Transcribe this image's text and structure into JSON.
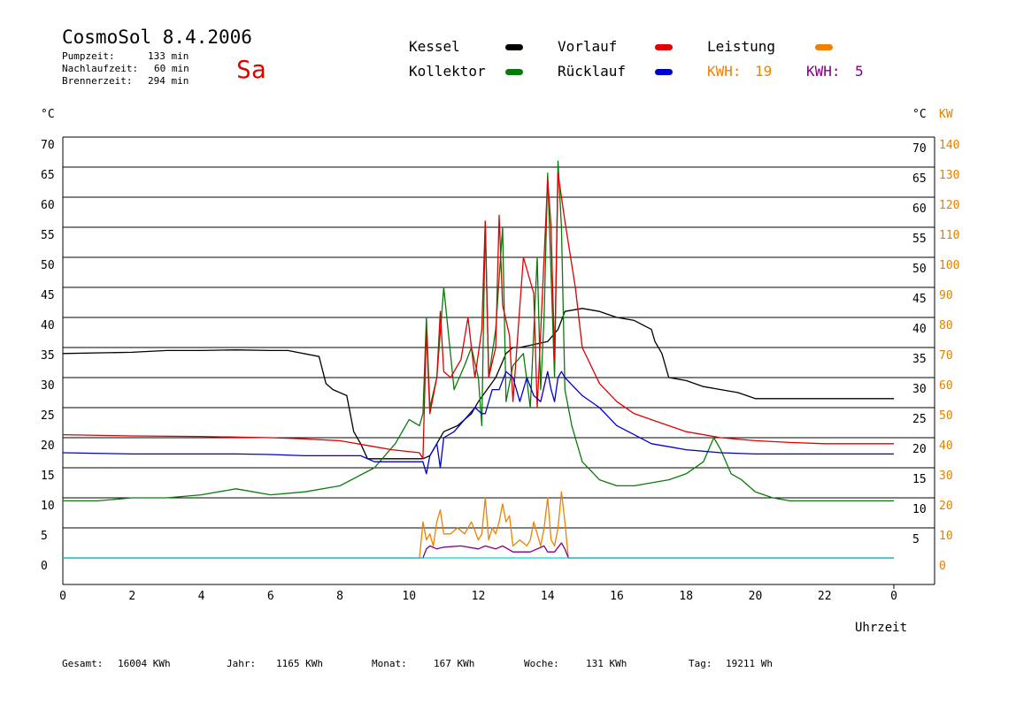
{
  "header": {
    "title": "CosmoSol 8.4.2006",
    "day": "Sa",
    "stats": [
      {
        "label": "Pumpzeit:",
        "value": "133 min"
      },
      {
        "label": "Nachlaufzeit:",
        "value": "60 min"
      },
      {
        "label": "Brennerzeit:",
        "value": "294 min"
      }
    ]
  },
  "legend": {
    "kessel": "Kessel",
    "kollektor": "Kollektor",
    "vorlauf": "Vorlauf",
    "ruecklauf": "Rücklauf",
    "leistung": "Leistung",
    "kwh1_label": "KWH:",
    "kwh1_value": "19",
    "kwh2_label": "KWH:",
    "kwh2_value": "5"
  },
  "colors": {
    "kessel": "#000000",
    "kollektor": "#0a7a0a",
    "vorlauf": "#e00000",
    "ruecklauf": "#0000cc",
    "leistung": "#f08000",
    "kwh2": "#800080",
    "pump": "#00d8d8",
    "kw_axis": "#e08000"
  },
  "footer": {
    "gesamt_label": "Gesamt:",
    "gesamt_value": "16004 KWh",
    "jahr_label": "Jahr:",
    "jahr_value": "1165 KWh",
    "monat_label": "Monat:",
    "monat_value": "167 KWh",
    "woche_label": "Woche:",
    "woche_value": "131 KWh",
    "tag_label": "Tag:",
    "tag_value": "19211 Wh"
  },
  "chart_data": {
    "type": "line",
    "xlabel": "Uhrzeit",
    "ylabel_left": "°C",
    "ylabel_right_c": "°C",
    "ylabel_right_kw": "KW",
    "xlim": [
      0,
      24
    ],
    "ylim": [
      0,
      70
    ],
    "y2lim": [
      0,
      140
    ],
    "grid": true,
    "x_ticks": [
      "0",
      "2",
      "4",
      "6",
      "8",
      "10",
      "12",
      "14",
      "16",
      "18",
      "20",
      "22",
      "0"
    ],
    "y_left_ticks": [
      "0",
      "5",
      "10",
      "15",
      "20",
      "25",
      "30",
      "35",
      "40",
      "45",
      "50",
      "55",
      "60",
      "65",
      "70"
    ],
    "y_right_c_ticks": [
      "5",
      "10",
      "15",
      "20",
      "25",
      "30",
      "35",
      "40",
      "45",
      "50",
      "55",
      "60",
      "65",
      "70"
    ],
    "y_right_kw_ticks": [
      "0",
      "10",
      "20",
      "30",
      "40",
      "50",
      "60",
      "70",
      "80",
      "90",
      "100",
      "110",
      "120",
      "130",
      "140"
    ],
    "series": [
      {
        "name": "Kessel",
        "color": "#000000",
        "x": [
          0,
          2,
          3,
          4,
          5,
          6,
          6.5,
          7.4,
          7.6,
          7.8,
          8.2,
          8.4,
          8.6,
          8.8,
          9.5,
          10.2,
          10.4,
          10.6,
          11,
          11.4,
          11.8,
          12,
          12.5,
          12.8,
          13,
          13.2,
          14,
          14.3,
          14.5,
          15,
          15.5,
          16,
          16.5,
          17,
          17.1,
          17.3,
          17.5,
          18,
          18.5,
          19,
          19.5,
          20,
          20.5,
          21,
          22,
          23,
          24
        ],
        "y": [
          34,
          34.2,
          34.5,
          34.5,
          34.6,
          34.5,
          34.5,
          33.5,
          29,
          28,
          27,
          21,
          19,
          16.5,
          16.5,
          16.5,
          16.5,
          17,
          21,
          22,
          24,
          26,
          30,
          34,
          35,
          35,
          36,
          38,
          41,
          41.5,
          41,
          40,
          39.5,
          38,
          36,
          34,
          30,
          29.5,
          28.5,
          28,
          27.5,
          26.5,
          26.5,
          26.5,
          26.5,
          26.5,
          26.5
        ]
      },
      {
        "name": "Kollektor",
        "color": "#0a7a0a",
        "x": [
          0,
          1,
          2,
          3,
          4,
          5,
          6,
          7,
          8,
          9,
          9.6,
          10,
          10.3,
          10.4,
          10.5,
          10.6,
          10.8,
          11,
          11.3,
          11.6,
          11.8,
          12,
          12.1,
          12.2,
          12.3,
          12.5,
          12.7,
          12.8,
          13,
          13.3,
          13.5,
          13.7,
          13.8,
          13.9,
          14,
          14.2,
          14.3,
          14.4,
          14.5,
          14.7,
          15,
          15.5,
          16,
          16.5,
          17,
          17.5,
          18,
          18.5,
          18.8,
          19,
          19.3,
          19.6,
          20,
          20.5,
          21,
          21.5,
          22,
          23,
          24
        ],
        "y": [
          9.5,
          9.5,
          10,
          10,
          10.5,
          11.5,
          10.5,
          11,
          12,
          15,
          19,
          23,
          22,
          24,
          40,
          25,
          30,
          45,
          28,
          32,
          35,
          30,
          22,
          56,
          30,
          38,
          55,
          26,
          32,
          34,
          25,
          50,
          28,
          40,
          64,
          30,
          66,
          55,
          28,
          22,
          16,
          13,
          12,
          12,
          12.5,
          13,
          14,
          16,
          20,
          18,
          14,
          13,
          11,
          10,
          9.5,
          9.5,
          9.5,
          9.5,
          9.5
        ]
      },
      {
        "name": "Vorlauf",
        "color": "#e00000",
        "x": [
          0,
          2,
          4,
          6,
          7,
          8,
          9,
          9.5,
          10.3,
          10.4,
          10.5,
          10.6,
          10.8,
          10.9,
          11,
          11.2,
          11.5,
          11.7,
          11.9,
          12.1,
          12.2,
          12.3,
          12.5,
          12.6,
          12.7,
          12.9,
          13,
          13.3,
          13.6,
          13.7,
          13.9,
          14,
          14.1,
          14.2,
          14.3,
          14.4,
          14.5,
          14.8,
          15,
          15.5,
          16,
          16.5,
          17,
          18,
          19,
          20,
          21,
          22,
          23,
          24
        ],
        "y": [
          20.5,
          20.3,
          20.2,
          20,
          19.8,
          19.5,
          18.5,
          18,
          17.5,
          16.5,
          38,
          24,
          30,
          41,
          31,
          30,
          33,
          40,
          30,
          38,
          56,
          30,
          35,
          57,
          42,
          37,
          26,
          50,
          44,
          25,
          50,
          63,
          55,
          33,
          64,
          60,
          56,
          45,
          35,
          29,
          26,
          24,
          23,
          21,
          20,
          19.5,
          19.2,
          19,
          19,
          19
        ]
      },
      {
        "name": "Rücklauf",
        "color": "#0000cc",
        "x": [
          0,
          2,
          4,
          5,
          6,
          7,
          8,
          8.6,
          9,
          10.4,
          10.5,
          10.6,
          10.8,
          10.9,
          11,
          11.3,
          11.6,
          11.9,
          12.1,
          12.2,
          12.4,
          12.6,
          12.8,
          13,
          13.2,
          13.4,
          13.6,
          13.8,
          14,
          14.1,
          14.2,
          14.3,
          14.4,
          14.5,
          15,
          15.5,
          16,
          16.5,
          17,
          18,
          19,
          20,
          21,
          22,
          23,
          24
        ],
        "y": [
          17.5,
          17.3,
          17.3,
          17.3,
          17.2,
          17,
          17,
          17,
          16,
          16,
          14,
          17,
          19,
          15,
          20,
          21,
          23,
          25,
          24,
          24,
          28,
          28,
          31,
          30,
          26,
          30,
          27,
          26,
          31,
          28,
          26,
          30,
          31,
          30,
          27,
          25,
          22,
          20.5,
          19,
          18,
          17.5,
          17.3,
          17.3,
          17.3,
          17.3,
          17.3
        ]
      },
      {
        "name": "Leistung",
        "color": "#f08000",
        "x": [
          0,
          10.3,
          10.4,
          10.5,
          10.6,
          10.7,
          10.8,
          10.9,
          11,
          11.2,
          11.4,
          11.6,
          11.8,
          12,
          12.1,
          12.2,
          12.3,
          12.4,
          12.5,
          12.6,
          12.7,
          12.8,
          12.9,
          13,
          13.2,
          13.4,
          13.5,
          13.6,
          13.7,
          13.8,
          13.9,
          14,
          14.1,
          14.2,
          14.3,
          14.4,
          14.5,
          14.6,
          15,
          24
        ],
        "y": [
          0,
          0,
          6,
          3,
          4,
          2,
          6,
          8,
          4,
          4,
          5,
          4,
          6,
          3,
          4,
          10,
          3,
          5,
          4,
          6,
          9,
          6,
          7,
          2,
          3,
          2,
          3,
          6,
          4,
          2,
          5,
          10,
          3,
          2,
          5,
          11,
          6,
          0,
          0,
          0
        ]
      },
      {
        "name": "KWH",
        "color": "#800080",
        "x": [
          0,
          10.4,
          10.5,
          10.6,
          10.8,
          11,
          11.5,
          12,
          12.2,
          12.5,
          12.7,
          13,
          13.5,
          13.9,
          14,
          14.2,
          14.4,
          14.5,
          14.6,
          24
        ],
        "y": [
          0,
          0,
          1.5,
          2,
          1.5,
          1.8,
          2,
          1.5,
          2,
          1.5,
          2,
          1,
          1,
          2,
          1,
          1,
          2.5,
          1.5,
          0,
          0
        ]
      },
      {
        "name": "Pumpe",
        "color": "#00d8d8",
        "x": [
          0,
          24
        ],
        "y": [
          0,
          0
        ]
      }
    ]
  }
}
